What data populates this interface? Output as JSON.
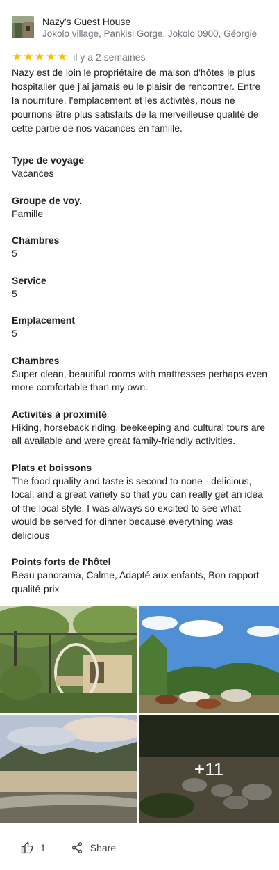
{
  "header": {
    "place_name": "Nazy's Guest House",
    "address": "Jokolo village, Pankisi Gorge, Jokolo 0900, Géorgie"
  },
  "review": {
    "rating": 5,
    "rating_stars": "★★★★★",
    "time": "il y a 2 semaines",
    "text": "Nazy est de loin le propriétaire de maison d'hôtes le plus hospitalier que j'ai jamais eu le plaisir de rencontrer. Entre la nourriture, l'emplacement et les activités, nous ne pourrions être plus satisfaits de la merveilleuse qualité de cette partie de nos vacances en famille."
  },
  "sections": [
    {
      "label": "Type de voyage",
      "value": "Vacances"
    },
    {
      "label": "Groupe de voy.",
      "value": "Famille"
    },
    {
      "label": "Chambres",
      "value": "5"
    },
    {
      "label": "Service",
      "value": "5"
    },
    {
      "label": "Emplacement",
      "value": "5"
    },
    {
      "label": "Chambres",
      "value": "Super clean, beautiful rooms with mattresses perhaps even more comfortable than my own."
    },
    {
      "label": "Activités à proximité",
      "value": "Hiking, horseback riding, beekeeping and cultural tours are all available and were great family-friendly activities."
    },
    {
      "label": "Plats et boissons",
      "value": "The food quality and taste is second to none - delicious, local, and a great variety so that you can really get an idea of the local style. I was always so excited to see what would be served for dinner because everything was delicious"
    },
    {
      "label": "Points forts de l'hôtel",
      "value": "Beau panorama, Calme, Adapté aux enfants, Bon rapport qualité-prix"
    }
  ],
  "photos": {
    "more_count": "+11"
  },
  "actions": {
    "like_count": "1",
    "share_label": "Share"
  },
  "colors": {
    "star": "#fbbc04",
    "text": "#202124",
    "secondary": "#70757a"
  },
  "icons": [
    "place-thumbnail",
    "star-icon",
    "thumbs-up-icon",
    "share-icon"
  ]
}
